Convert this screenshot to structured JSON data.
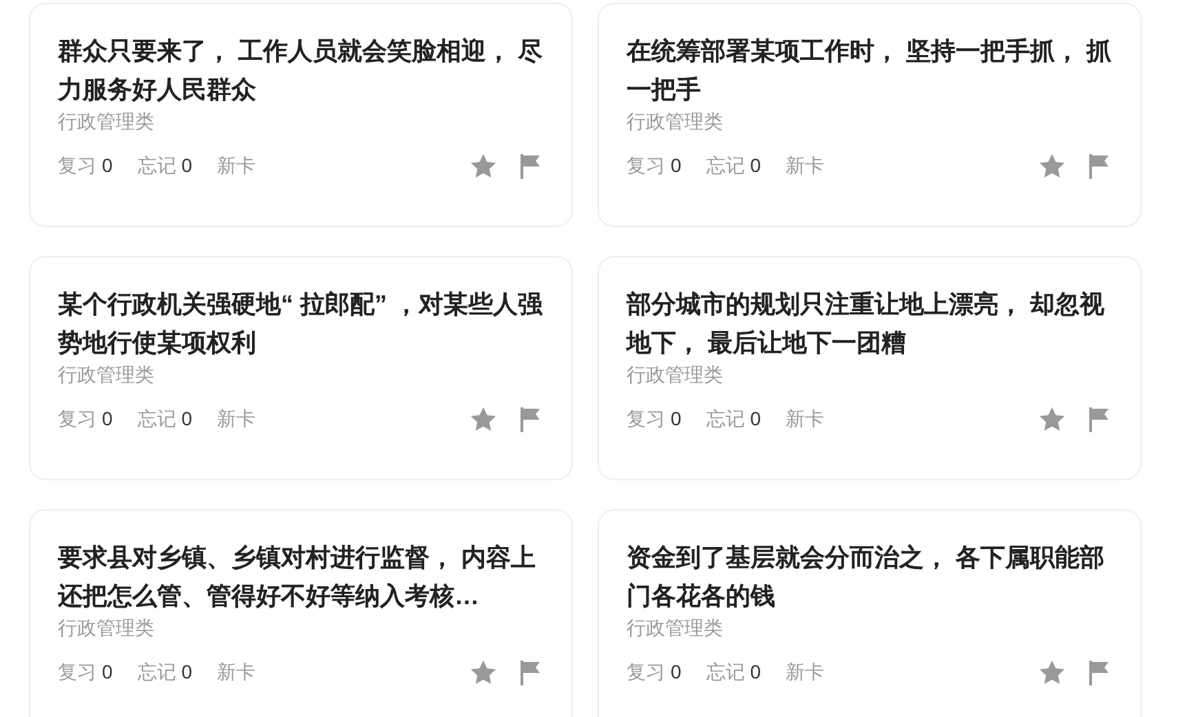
{
  "cards": [
    {
      "title": "群众只要来了， 工作人员就会笑脸相迎， 尽力服务好人民群众",
      "category": "行政管理类",
      "stats": [
        {
          "label": "复习",
          "count": "0"
        },
        {
          "label": "忘记",
          "count": "0"
        }
      ],
      "tag": "新卡"
    },
    {
      "title": "在统筹部署某项工作时， 坚持一把手抓， 抓一把手",
      "category": "行政管理类",
      "stats": [
        {
          "label": "复习",
          "count": "0"
        },
        {
          "label": "忘记",
          "count": "0"
        }
      ],
      "tag": "新卡"
    },
    {
      "title": "某个行政机关强硬地“ 拉郎配” ，对某些人强势地行使某项权利",
      "category": "行政管理类",
      "stats": [
        {
          "label": "复习",
          "count": "0"
        },
        {
          "label": "忘记",
          "count": "0"
        }
      ],
      "tag": "新卡"
    },
    {
      "title": "部分城市的规划只注重让地上漂亮， 却忽视地下， 最后让地下一团糟",
      "category": "行政管理类",
      "stats": [
        {
          "label": "复习",
          "count": "0"
        },
        {
          "label": "忘记",
          "count": "0"
        }
      ],
      "tag": "新卡"
    },
    {
      "title": "要求县对乡镇、乡镇对村进行监督， 内容上还把怎么管、管得好不好等纳入考核…",
      "category": "行政管理类",
      "stats": [
        {
          "label": "复习",
          "count": "0"
        },
        {
          "label": "忘记",
          "count": "0"
        }
      ],
      "tag": "新卡"
    },
    {
      "title": "资金到了基层就会分而治之， 各下属职能部门各花各的钱",
      "category": "行政管理类",
      "stats": [
        {
          "label": "复习",
          "count": "0"
        },
        {
          "label": "忘记",
          "count": "0"
        }
      ],
      "tag": "新卡"
    }
  ]
}
